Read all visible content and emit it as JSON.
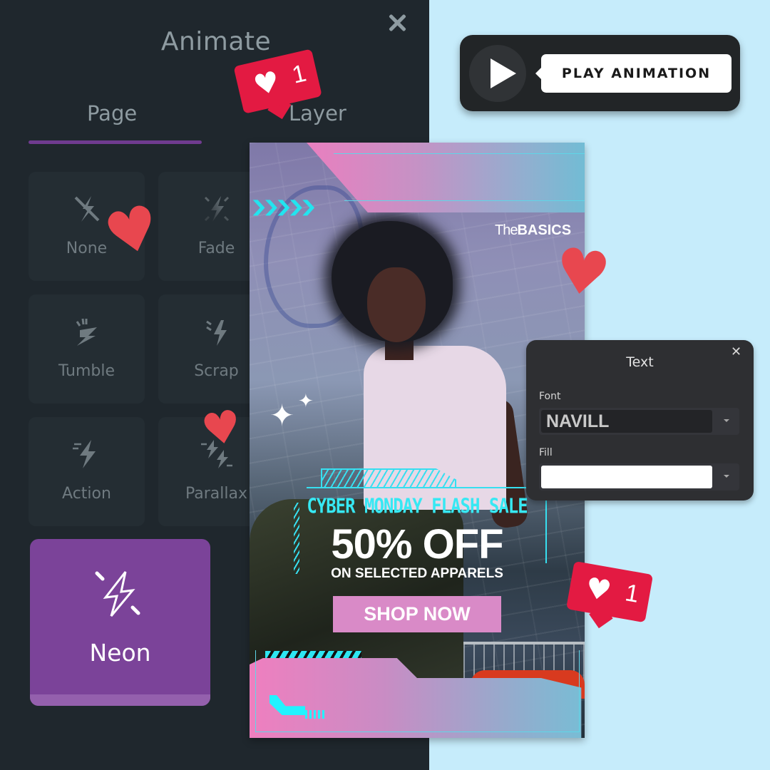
{
  "animate_panel": {
    "title": "Animate",
    "close_icon": "close-icon",
    "tabs": [
      {
        "label": "Page",
        "active": true
      },
      {
        "label": "Layer",
        "active": false
      }
    ],
    "animations": [
      {
        "label": "None",
        "icon": "no-animation-icon"
      },
      {
        "label": "Fade",
        "icon": "fade-bolt-icon"
      },
      {
        "label": "Tumble",
        "icon": "tumble-bolt-icon"
      },
      {
        "label": "Scrap",
        "icon": "scrap-bolt-icon"
      },
      {
        "label": "Action",
        "icon": "action-bolt-icon"
      },
      {
        "label": "Parallax",
        "icon": "parallax-bolt-icon"
      },
      {
        "label": "Neon",
        "icon": "neon-bolt-icon",
        "selected": true
      }
    ],
    "accent_color": "#7b4399"
  },
  "play_widget": {
    "label": "PLAY ANIMATION",
    "icon": "play-icon"
  },
  "design": {
    "brand_thin": "The",
    "brand_bold": "BASICS",
    "chevrons": "❯❯❯❯❯",
    "headline": "CYBER MONDAY FLASH SALE",
    "offer": "50% OFF",
    "subline": "ON SELECTED APPARELS",
    "cta": "SHOP NOW",
    "neon_color": "#37e8f3",
    "cta_color": "#d98ac7"
  },
  "text_panel": {
    "title": "Text",
    "close_glyph": "✕",
    "font_label": "Font",
    "font_value": "NAVILL",
    "fill_label": "Fill",
    "fill_color": "#ffffff"
  },
  "decorations": {
    "like_count_top": "1",
    "like_count_bottom": "1",
    "heart_glyph": "♥",
    "sparkle_glyph": "✦",
    "heart_color": "#e8474f",
    "badge_color": "#e31a42"
  }
}
